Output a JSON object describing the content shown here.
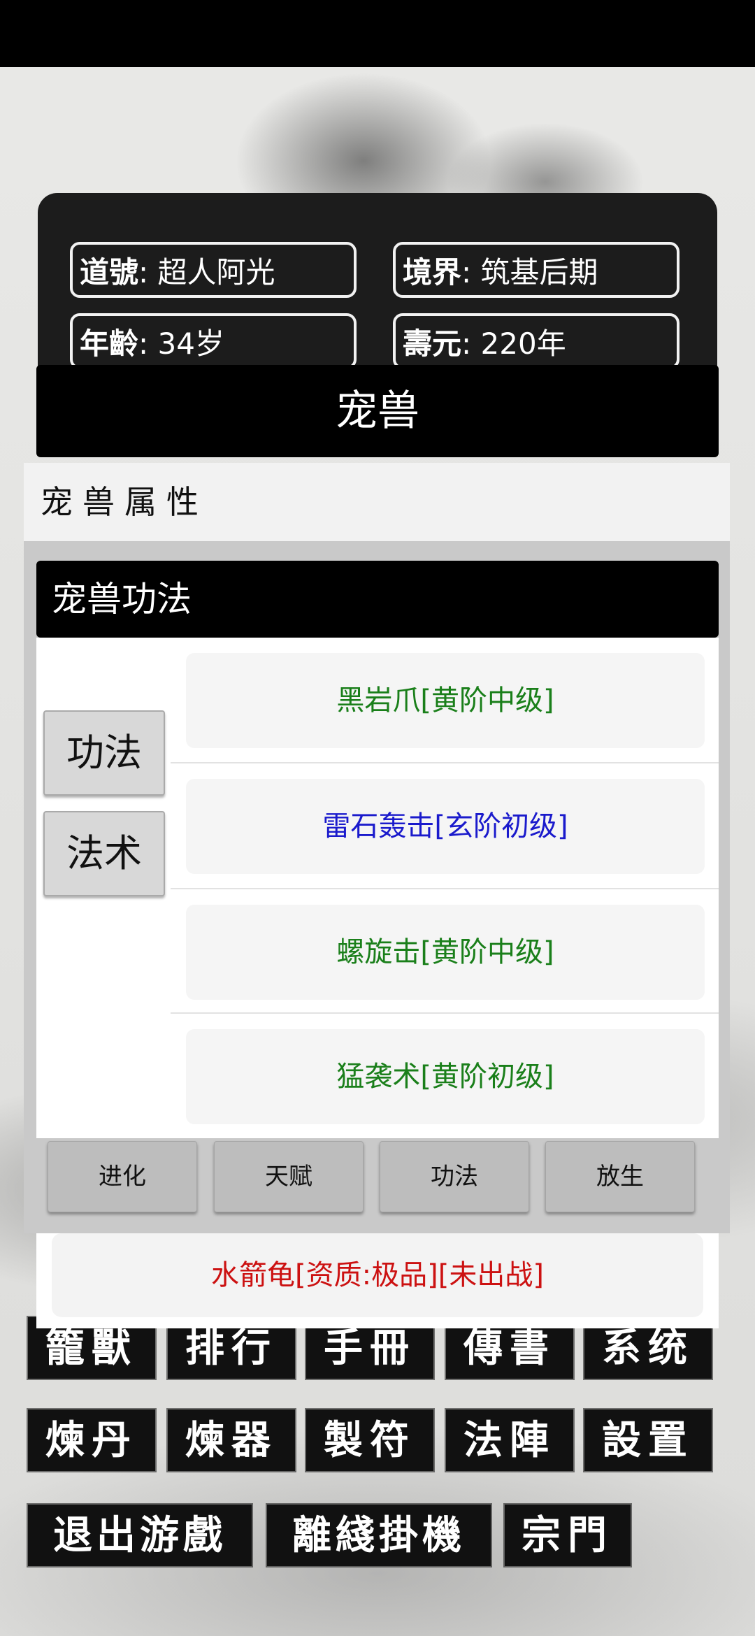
{
  "player": {
    "daohao_key": "道號",
    "daohao_value": "超人阿光",
    "jingjie_key": "境界",
    "jingjie_value": "筑基后期",
    "age_key": "年齡",
    "age_value": "34岁",
    "shouyuan_key": "壽元",
    "shouyuan_value": "220年"
  },
  "menu": {
    "row1": [
      "籠獸",
      "排行",
      "手冊",
      "傳書",
      "系统"
    ],
    "row2": [
      "煉丹",
      "煉器",
      "製符",
      "法陣",
      "設置"
    ],
    "row3": [
      "退出游戲",
      "離綫掛機",
      "宗門"
    ]
  },
  "pet_list": {
    "item": "水箭龟[资质:极品][未出战]",
    "item_color": "#cc1111"
  },
  "dialog": {
    "title": "宠兽",
    "attr_header": "宠兽属性",
    "skill_header": "宠兽功法",
    "side_tabs": [
      "功法",
      "法术"
    ],
    "skills": [
      {
        "name": "黑岩爪[黄阶中级]",
        "color": "#1a7f1a"
      },
      {
        "name": "雷石轰击[玄阶初级]",
        "color": "#1a1acc"
      },
      {
        "name": "螺旋击[黄阶中级]",
        "color": "#1a7f1a"
      },
      {
        "name": "猛袭术[黄阶初级]",
        "color": "#1a7f1a"
      }
    ],
    "actions": [
      "进化",
      "天赋",
      "功法",
      "放生"
    ]
  }
}
